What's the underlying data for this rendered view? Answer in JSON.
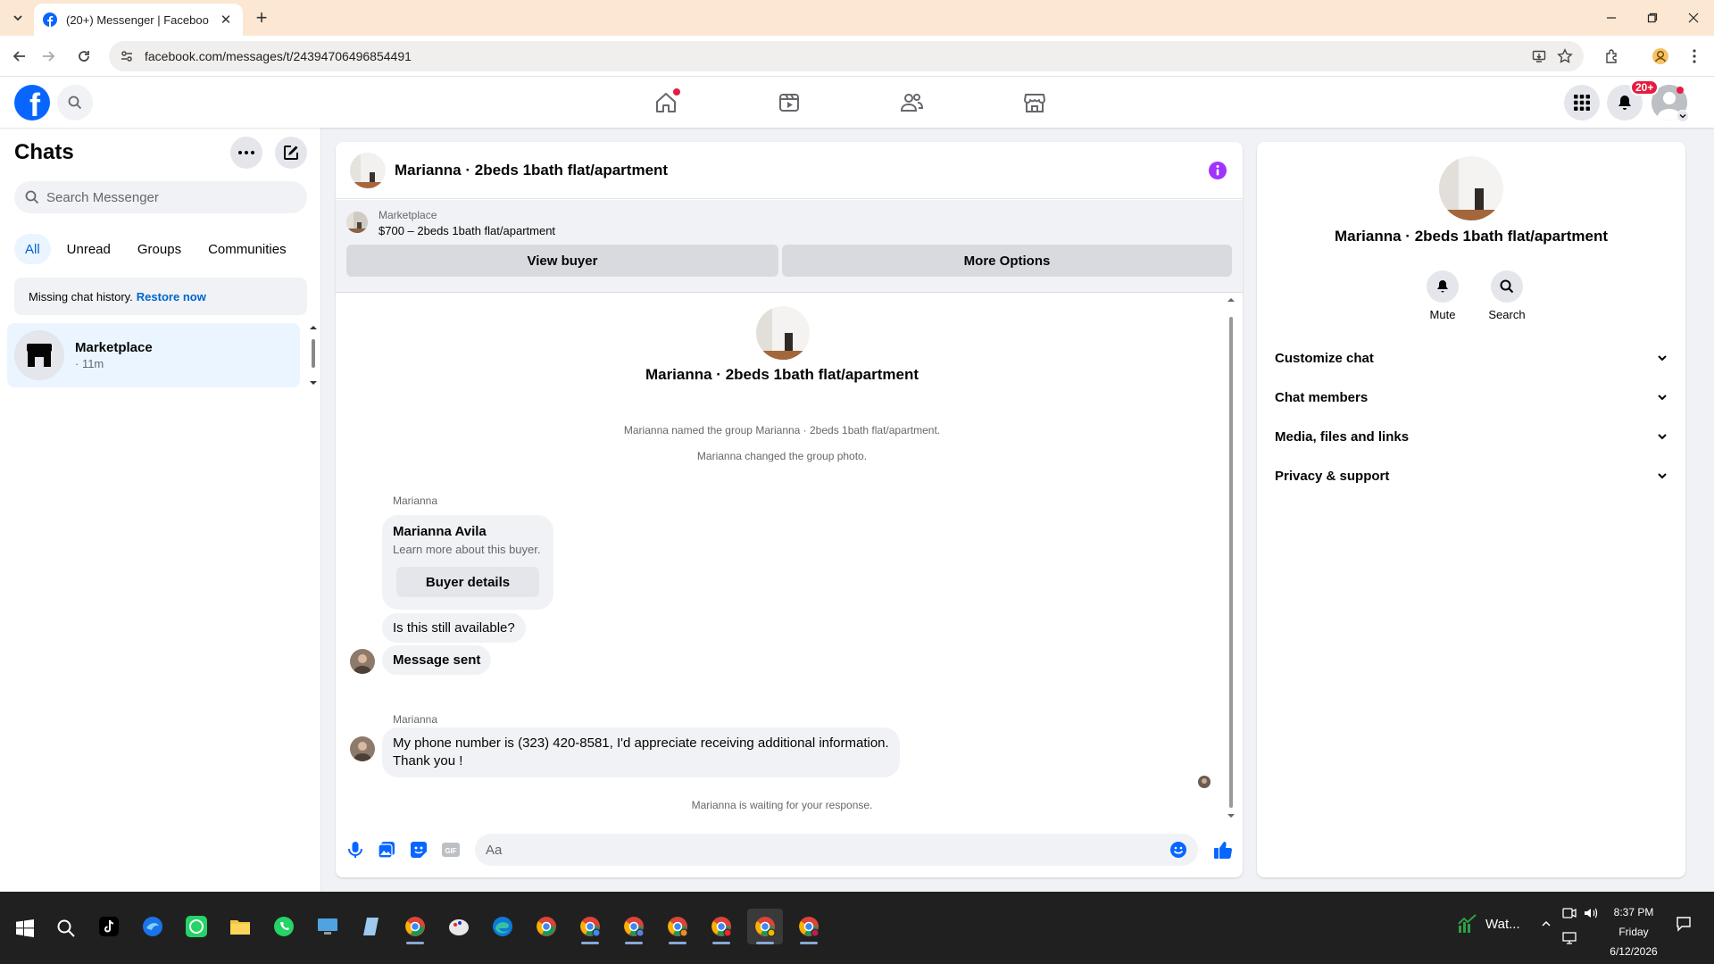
{
  "browser": {
    "tab_title": "(20+) Messenger | Facebook",
    "url": "facebook.com/messages/t/24394706496854491"
  },
  "header": {
    "notification_badge": "20+"
  },
  "chats": {
    "heading": "Chats",
    "search_placeholder": "Search Messenger",
    "filters": [
      "All",
      "Unread",
      "Groups",
      "Communities"
    ],
    "notice_text": "Missing chat history.",
    "notice_link": "Restore now",
    "items": [
      {
        "name": "Marketplace",
        "time": "· 11m"
      }
    ]
  },
  "conversation": {
    "title": "Marianna · 2beds 1bath flat/apartment",
    "marketplace_label": "Marketplace",
    "listing": "$700 – 2beds 1bath flat/apartment",
    "view_buyer": "View buyer",
    "more_options": "More Options",
    "system_messages": [
      "Marianna named the group Marianna · 2beds 1bath flat/apartment.",
      "Marianna changed the group photo."
    ],
    "sender_1": "Marianna",
    "buyer_card": {
      "name": "Marianna Avila",
      "subtitle": "Learn more about this buyer.",
      "button": "Buyer details"
    },
    "msg_available": "Is this still available?",
    "msg_sent": "Message sent",
    "sender_2": "Marianna",
    "msg_phone_line1": "My phone number is (323) 420-8581, I'd appreciate receiving additional information.",
    "msg_phone_line2": "Thank you !",
    "waiting": "Marianna is waiting for your response.",
    "composer_placeholder": "Aa"
  },
  "info_panel": {
    "name": "Marianna · 2beds 1bath flat/apartment",
    "mute": "Mute",
    "search": "Search",
    "sections": [
      "Customize chat",
      "Chat members",
      "Media, files and links",
      "Privacy & support"
    ]
  },
  "taskbar": {
    "weather": "Wat...",
    "time": "8:37 PM",
    "day": "Friday",
    "date": "6/12/2026"
  },
  "colors": {
    "facebook_blue": "#0866ff",
    "messenger_accent": "#a033ff",
    "badge_red": "#e41e3f"
  }
}
